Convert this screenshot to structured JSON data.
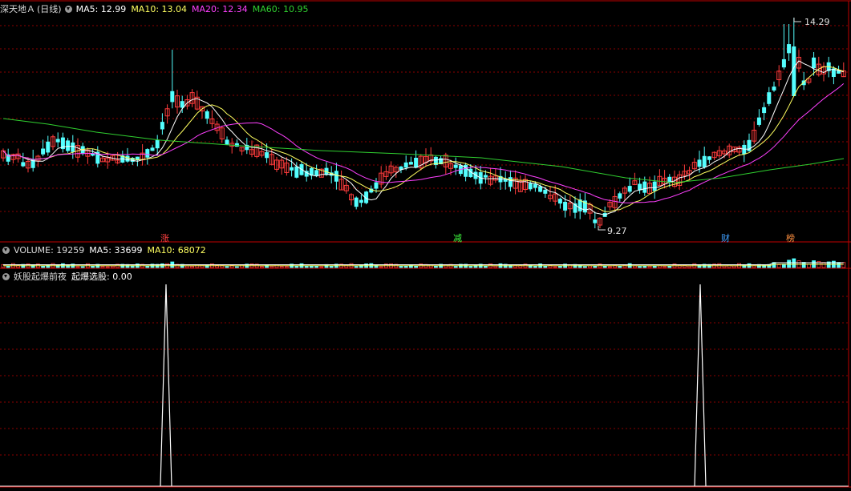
{
  "colors": {
    "up": "#ff3c3c",
    "down": "#54ffff",
    "ma5": "#ffffff",
    "ma10": "#ffff60",
    "ma20": "#ff40ff",
    "ma60": "#30d030",
    "grid": "#8b0000",
    "divider": "#c00000"
  },
  "price_pane": {
    "stock_name": "深天地Ａ",
    "period": "(日线)",
    "ma5_label": "MA5: 12.99",
    "ma10_label": "MA10: 13.04",
    "ma20_label": "MA20: 12.34",
    "ma60_label": "MA60: 10.95",
    "high_label": "14.29",
    "low_label": "9.27",
    "markers": [
      {
        "text": "涨",
        "color": "#ff4040"
      },
      {
        "text": "减",
        "color": "#40ff40"
      },
      {
        "text": "财",
        "color": "#40a0ff"
      },
      {
        "text": "榜",
        "color": "#ff9040"
      }
    ]
  },
  "volume_pane": {
    "title": "VOLUME: 19259",
    "ma5_label": "MA5: 33699",
    "ma10_label": "MA10: 68072"
  },
  "signal_pane": {
    "title": "妖股起爆前夜",
    "value_label": "起爆选股: 0.00"
  }
}
